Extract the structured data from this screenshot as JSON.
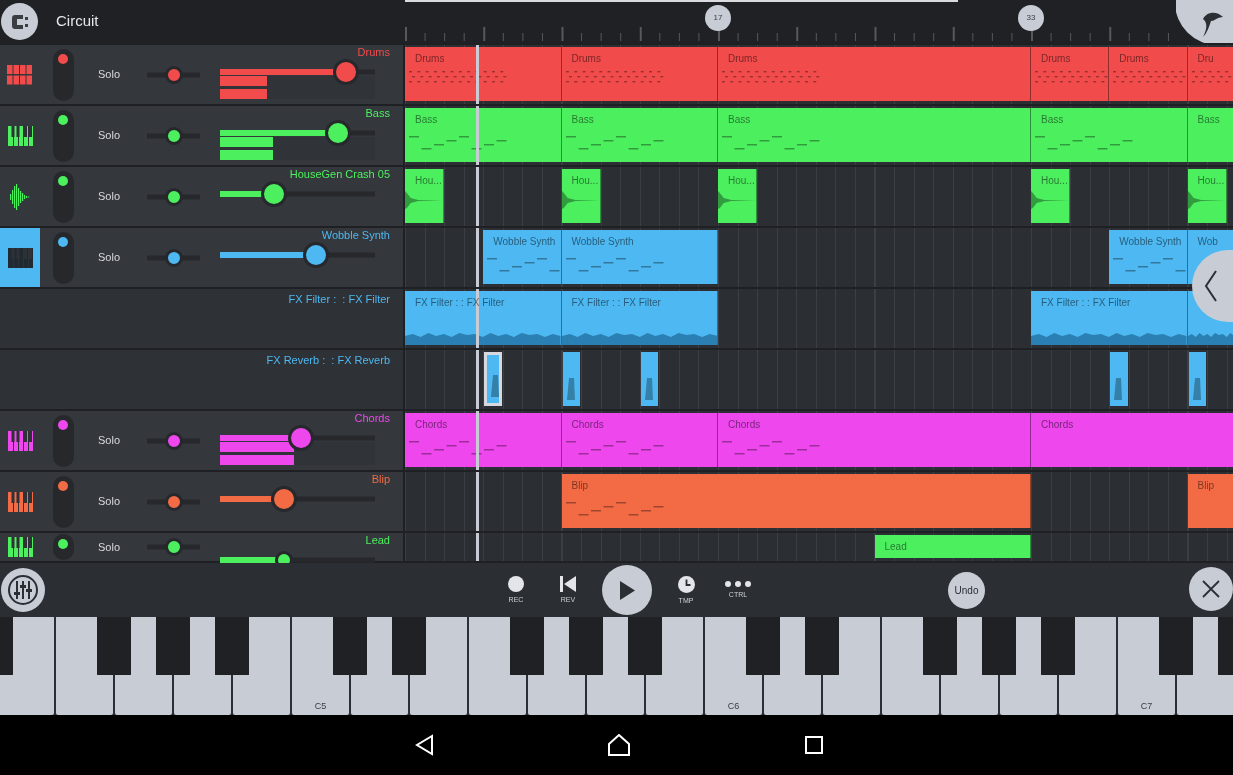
{
  "header": {
    "title": "Circuit"
  },
  "ruler": {
    "markers": [
      {
        "label": "17"
      },
      {
        "label": "33"
      }
    ]
  },
  "tracks": [
    {
      "name": "Drums",
      "kind": "drums",
      "color": "#f24b4b",
      "selected": false,
      "on": true,
      "solo_label": "Solo",
      "pan": {
        "level": 0.5
      },
      "volume": {
        "level": 0.81
      },
      "meter": {
        "level": 0.3
      },
      "clips": [
        {
          "label": "Drums",
          "selected": false
        },
        {
          "label": "Drums",
          "selected": false
        },
        {
          "label": "Drums",
          "selected": false
        },
        {
          "label": "Drums",
          "selected": false
        },
        {
          "label": "Drums",
          "selected": false
        },
        {
          "label": "Dru",
          "selected": false
        }
      ]
    },
    {
      "name": "Bass",
      "kind": "synth",
      "color": "#4cf05f",
      "selected": false,
      "on": true,
      "solo_label": "Solo",
      "pan": {
        "level": 0.5
      },
      "volume": {
        "level": 0.76
      },
      "meter": {
        "level": 0.34
      },
      "clips": [
        {
          "label": "Bass",
          "selected": false
        },
        {
          "label": "Bass",
          "selected": false
        },
        {
          "label": "Bass",
          "selected": false
        },
        {
          "label": "Bass",
          "selected": false
        },
        {
          "label": "Bass",
          "selected": false
        }
      ]
    },
    {
      "name": "HouseGen Crash 05",
      "kind": "sample",
      "color": "#4cf05f",
      "selected": false,
      "on": true,
      "solo_label": "Solo",
      "pan": {
        "level": 0.5
      },
      "volume": {
        "level": 0.35
      },
      "clips": [
        {
          "label": "Hou...",
          "selected": false
        },
        {
          "label": "Hou...",
          "selected": false
        },
        {
          "label": "Hou...",
          "selected": false
        },
        {
          "label": "Hou...",
          "selected": false
        },
        {
          "label": "Hou...",
          "selected": false
        }
      ]
    },
    {
      "name": "Wobble Synth",
      "kind": "synth",
      "color": "#4db8f2",
      "selected": true,
      "on": true,
      "solo_label": "Solo",
      "pan": {
        "level": 0.5
      },
      "volume": {
        "level": 0.62
      },
      "clips": [
        {
          "label": "Wobble Synth",
          "selected": false
        },
        {
          "label": "Wobble Synth",
          "selected": false
        },
        {
          "label": "Wobble Synth",
          "selected": false
        },
        {
          "label": "Wob",
          "selected": false
        }
      ]
    },
    {
      "name": "FX Filter :  : FX Filter",
      "kind": "fx_filter",
      "color": "#4db8f2",
      "clips": [
        {
          "label": "FX Filter :  : FX Filter",
          "selected": false
        },
        {
          "label": "FX Filter :  : FX Filter",
          "selected": false
        },
        {
          "label": "FX Filter :  : FX Filter",
          "selected": false
        },
        {
          "selected": false
        }
      ]
    },
    {
      "name": "FX Reverb :  : FX Reverb",
      "kind": "fx_reverb",
      "color": "#4db8f2",
      "clips": [
        {
          "selected": true
        },
        {
          "selected": false
        },
        {
          "selected": false
        },
        {
          "selected": false
        },
        {
          "selected": false
        }
      ]
    },
    {
      "name": "Chords",
      "kind": "synth",
      "color": "#ee47ee",
      "selected": false,
      "on": true,
      "solo_label": "Solo",
      "pan": {
        "level": 0.5
      },
      "volume": {
        "level": 0.52
      },
      "meter": {
        "level": 0.48
      },
      "clips": [
        {
          "label": "Chords",
          "selected": false
        },
        {
          "label": "Chords",
          "selected": false
        },
        {
          "label": "Chords",
          "selected": false
        },
        {
          "label": "Chords",
          "selected": false
        }
      ]
    },
    {
      "name": "Blip",
      "kind": "synth",
      "color": "#f26b45",
      "selected": false,
      "on": true,
      "solo_label": "Solo",
      "pan": {
        "level": 0.5
      },
      "volume": {
        "level": 0.41
      },
      "clips": [
        {
          "label": "Blip",
          "selected": false
        },
        {
          "label": "Blip",
          "selected": false
        }
      ]
    },
    {
      "name": "Lead",
      "kind": "synth",
      "color": "#4cf05f",
      "selected": false,
      "on": true,
      "solo_label": "Solo",
      "pan": {
        "level": 0.5
      },
      "volume": {
        "level": 0.41
      },
      "clips": [
        {
          "label": "Lead",
          "selected": false
        }
      ]
    }
  ],
  "transport": [
    {
      "kind": "rec",
      "label": "REC"
    },
    {
      "kind": "rev",
      "label": "REV"
    },
    {
      "kind": "play"
    },
    {
      "kind": "tmp",
      "label": "TMP"
    },
    {
      "kind": "ctrl",
      "label": "CTRL"
    }
  ],
  "undo": {
    "label": "Undo"
  },
  "keyboard": {
    "octave_labels": [
      "C5",
      "C6",
      "C7"
    ]
  }
}
